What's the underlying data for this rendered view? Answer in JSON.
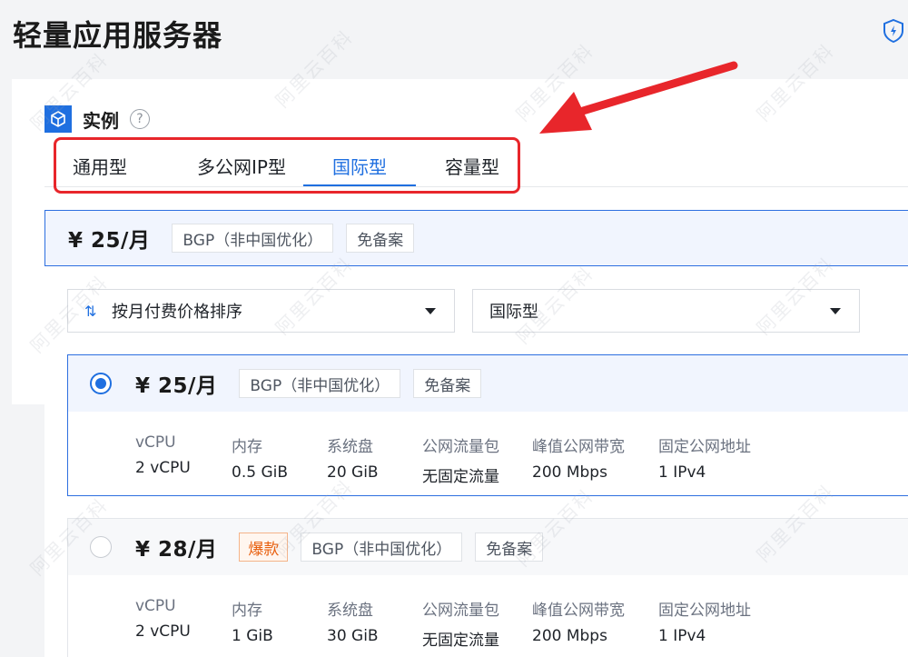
{
  "header": {
    "title": "轻量应用服务器",
    "shield_icon": "shield-lightning-icon"
  },
  "section": {
    "label": "实例",
    "help_symbol": "?"
  },
  "tabs": [
    {
      "label": "通用型",
      "active": false
    },
    {
      "label": "多公网IP型",
      "active": false
    },
    {
      "label": "国际型",
      "active": true
    },
    {
      "label": "容量型",
      "active": false
    }
  ],
  "summary": {
    "price": "¥ 25/月",
    "tags": [
      "BGP（非中国优化）",
      "免备案"
    ]
  },
  "filters": {
    "sort": {
      "selected": "按月付费价格排序",
      "icon": "⇅"
    },
    "type": {
      "selected": "国际型"
    }
  },
  "spec_labels": [
    "vCPU",
    "内存",
    "系统盘",
    "公网流量包",
    "峰值公网带宽",
    "固定公网地址"
  ],
  "plans": [
    {
      "price": "¥ 25/月",
      "hot": "",
      "tags": [
        "BGP（非中国优化）",
        "免备案"
      ],
      "selected": true,
      "specs": [
        "2 vCPU",
        "0.5 GiB",
        "20 GiB",
        "无固定流量",
        "200 Mbps",
        "1 IPv4"
      ]
    },
    {
      "price": "¥ 28/月",
      "hot": "爆款",
      "tags": [
        "BGP（非中国优化）",
        "免备案"
      ],
      "selected": false,
      "specs": [
        "2 vCPU",
        "1 GiB",
        "30 GiB",
        "无固定流量",
        "200 Mbps",
        "1 IPv4"
      ]
    }
  ],
  "watermark": "阿里云百科",
  "colors": {
    "accent": "#1f6fe0",
    "highlight": "#e8262b",
    "hot": "#e8600f"
  }
}
